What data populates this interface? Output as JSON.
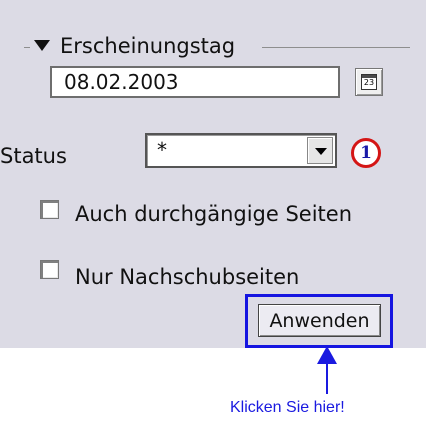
{
  "section": {
    "title": "Erscheinungstag",
    "collapse_icon": "triangle-down-icon"
  },
  "date_field": {
    "value": "08.02.2003",
    "calendar_icon": "calendar-icon",
    "calendar_day": "23"
  },
  "status": {
    "label": "Status",
    "selected": "*",
    "dropdown_icon": "chevron-down-icon"
  },
  "step_badge": {
    "number": "1",
    "color": "#d41515"
  },
  "checkboxes": [
    {
      "label": "Auch durchgängige Seiten",
      "checked": false
    },
    {
      "label": "Nur Nachschubseiten",
      "checked": false
    }
  ],
  "apply_button": {
    "label": "Anwenden",
    "highlight_color": "#1515e0"
  },
  "callout": {
    "text": "Klicken Sie hier!",
    "arrow_icon": "arrow-up-icon",
    "color": "#1a1ae0"
  }
}
